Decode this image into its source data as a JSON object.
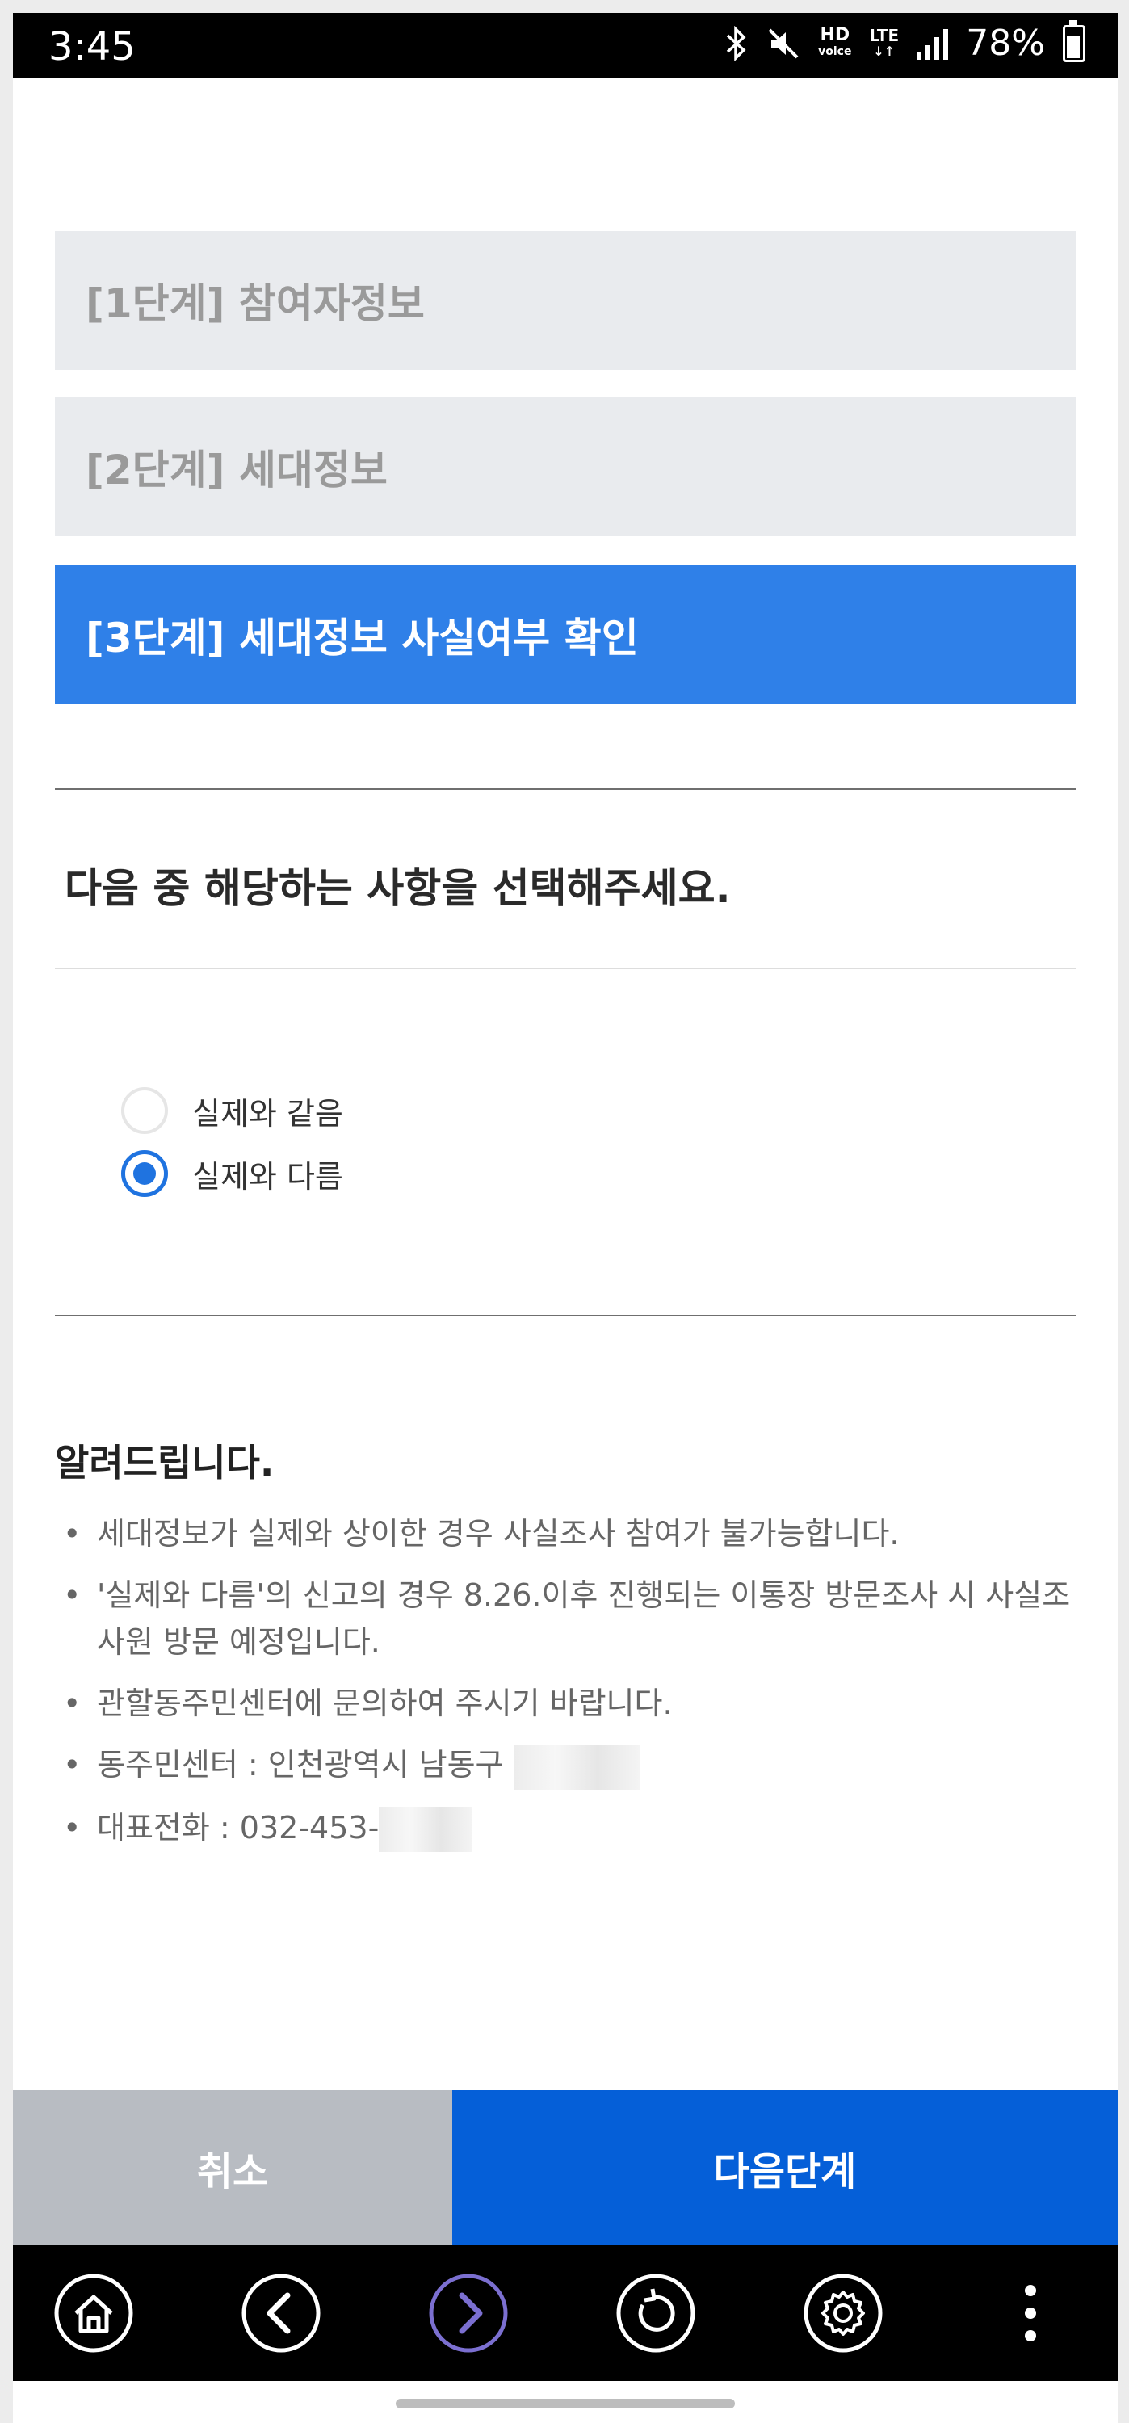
{
  "status_bar": {
    "time": "3:45",
    "hd_top": "HD",
    "hd_bottom": "voice",
    "lte": "LTE",
    "battery_percent": "78%"
  },
  "steps": [
    {
      "label": "[1단계] 참여자정보",
      "active": false
    },
    {
      "label": "[2단계] 세대정보",
      "active": false
    },
    {
      "label": "[3단계] 세대정보 사실여부 확인",
      "active": true
    }
  ],
  "question": "다음 중 해당하는 사항을 선택해주세요.",
  "options": [
    {
      "label": "실제와 같음",
      "selected": false
    },
    {
      "label": "실제와 다름",
      "selected": true
    }
  ],
  "notice": {
    "title": "알려드립니다.",
    "items": [
      "세대정보가 실제와 상이한 경우 사실조사 참여가 불가능합니다.",
      "'실제와 다름'의 신고의 경우 8.26.이후 진행되는 이통장 방문조사 시 사실조사원 방문 예정입니다.",
      "관할동주민센터에 문의하여 주시기 바랍니다.",
      "동주민센터 : 인천광역시 남동구",
      "대표전화 : 032-453-"
    ]
  },
  "buttons": {
    "cancel": "취소",
    "next": "다음단계"
  },
  "colors": {
    "active_step": "#2f80e8",
    "next_button": "#055fd8",
    "cancel_button": "#b8bcc2",
    "radio_selected": "#1f73e0"
  },
  "nav_icons": [
    "home-icon",
    "back-icon",
    "forward-icon",
    "refresh-icon",
    "settings-icon",
    "more-icon"
  ]
}
